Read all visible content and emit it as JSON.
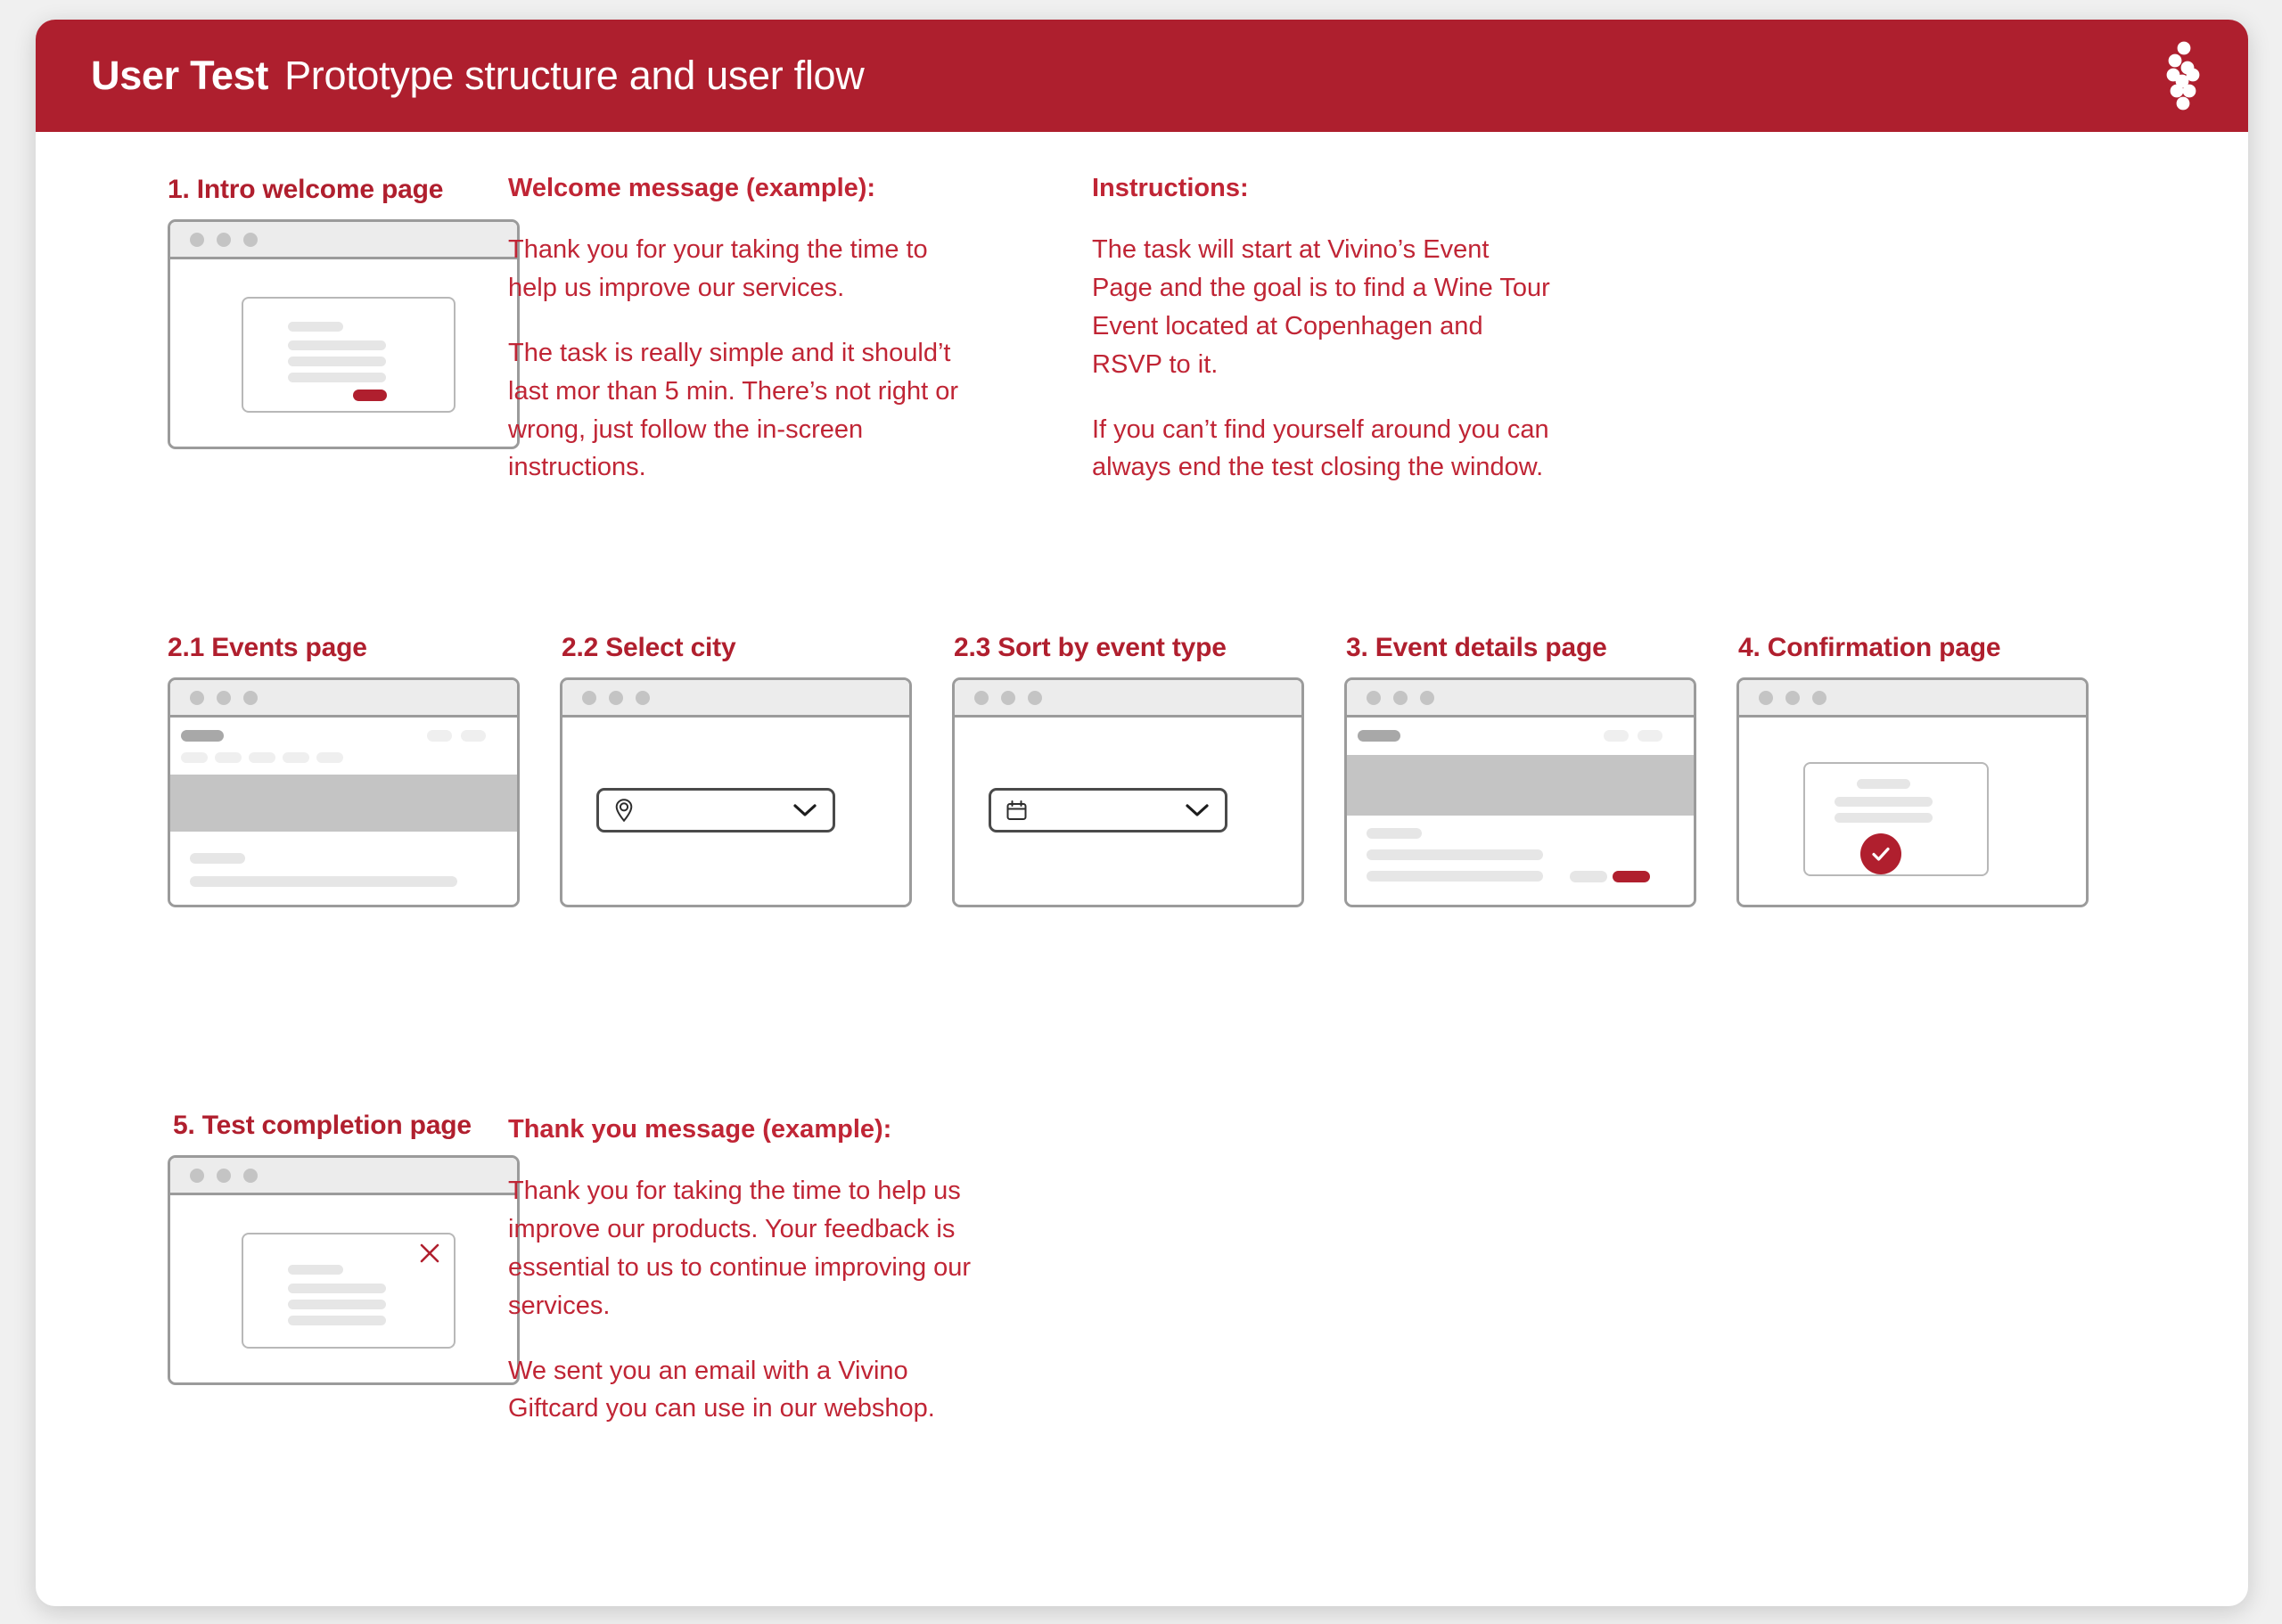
{
  "header": {
    "title_strong": "User Test",
    "title_sub": "Prototype structure and user flow",
    "logo_name": "vivino-grape-logo",
    "bg_color": "#AE1F2E"
  },
  "theme": {
    "brand_red": "#B01F2E",
    "text_red": "#C02535",
    "wire_border": "#9b9b9b",
    "wire_bar": "#e6e6e6",
    "wire_band": "#c4c4c4"
  },
  "sections": {
    "step1": {
      "label": "1. Intro welcome page",
      "wireframe_name": "wireframe-intro-welcome-page"
    },
    "step21": {
      "label": "2.1 Events page",
      "wireframe_name": "wireframe-events-page"
    },
    "step22": {
      "label": "2.2 Select city",
      "wireframe_name": "wireframe-select-city",
      "field_icon": "location-pin-icon",
      "dropdown_icon": "chevron-down-icon"
    },
    "step23": {
      "label": "2.3 Sort by event type",
      "wireframe_name": "wireframe-sort-by-event-type",
      "field_icon": "calendar-icon",
      "dropdown_icon": "chevron-down-icon"
    },
    "step3": {
      "label": "3. Event details page",
      "wireframe_name": "wireframe-event-details-page"
    },
    "step4": {
      "label": "4. Confirmation page",
      "wireframe_name": "wireframe-confirmation-page",
      "status_icon": "check-circle-icon"
    },
    "step5": {
      "label": "5. Test completion page",
      "wireframe_name": "wireframe-test-completion-page",
      "close_icon": "close-x-icon"
    }
  },
  "welcome_message": {
    "heading": "Welcome message (example):",
    "paragraph_1": "Thank you for your taking the time to help us improve our services.",
    "paragraph_2": "The task is really simple and it should’t last mor than 5 min. There’s not right or wrong, just follow the in-screen instructions."
  },
  "instructions": {
    "heading": "Instructions:",
    "paragraph_1": "The task will start at Vivino’s Event Page and the goal is to find a Wine Tour Event located at Copenhagen and RSVP to it.",
    "paragraph_2": "If you can’t find yourself around you can always end the test closing the window."
  },
  "thank_you_message": {
    "heading": "Thank you message (example):",
    "paragraph_1": "Thank you for taking the time to help us improve our products. Your feedback is essential to us to continue improving our services.",
    "paragraph_2": "We sent you an email with a Vivino Giftcard you can use in our webshop."
  }
}
